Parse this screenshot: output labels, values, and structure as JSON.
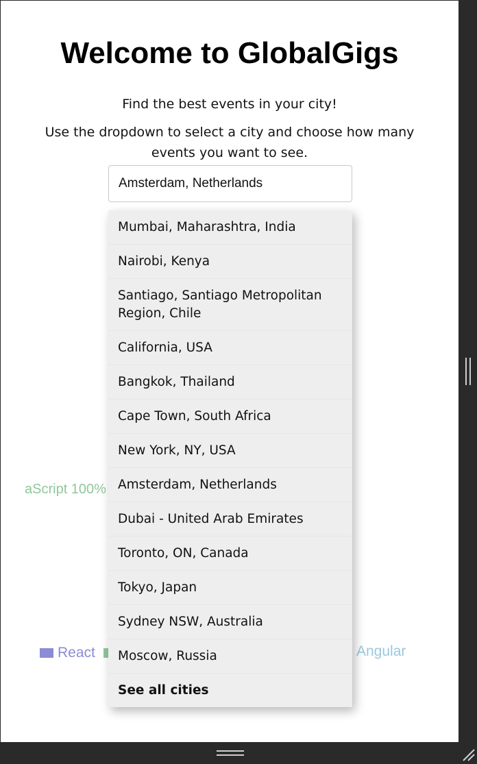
{
  "page": {
    "title": "Welcome to GlobalGigs",
    "tagline": "Find the best events in your city!",
    "instructions": "Use the dropdown to select a city and choose how many events you want to see."
  },
  "city_select": {
    "selected": "Amsterdam, Netherlands"
  },
  "dropdown": {
    "items": [
      "Mumbai, Maharashtra, India",
      "Nairobi, Kenya",
      "Santiago, Santiago Metropolitan Region, Chile",
      "California, USA",
      "Bangkok, Thailand",
      "Cape Town, South Africa",
      "New York, NY, USA",
      "Amsterdam, Netherlands",
      "Dubai - United Arab Emirates",
      "Toronto, ON, Canada",
      "Tokyo, Japan",
      "Sydney NSW, Australia",
      "Moscow, Russia"
    ],
    "see_all": "See all cities"
  },
  "background_chart": {
    "fragment_label": "aScript 100%",
    "legend": [
      {
        "label": "React",
        "color": "#8b8bd6"
      },
      {
        "label": "Angular",
        "color": "#9ac8dc"
      }
    ],
    "partial_swatch_color": "#8fc79a"
  }
}
